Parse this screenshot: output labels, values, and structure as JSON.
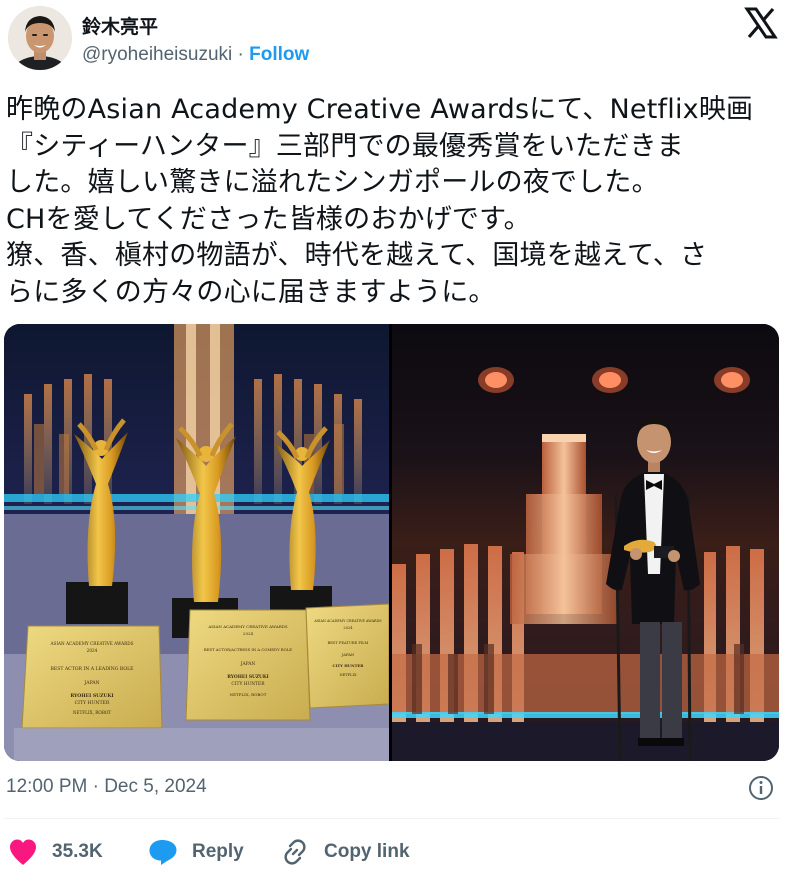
{
  "author": {
    "display_name": "鈴木亮平",
    "handle": "@ryoheiheisuzuki",
    "separator": " · ",
    "follow_label": "Follow"
  },
  "tweet": {
    "lines": [
      "昨晩のAsian Academy Creative Awardsにて、Netflix映画",
      "『シティーハンター』三部門での最優秀賞をいただきま",
      "した。嬉しい驚きに溢れたシンガポールの夜でした。",
      "CHを愛してくださった皆様のおかげです。",
      "獠、香、槇村の物語が、時代を越えて、国境を越えて、さ",
      "らに多くの方々の心に届きますように。"
    ],
    "timestamp": "12:00 PM · Dec 5, 2024"
  },
  "media": {
    "left_photo": {
      "plaques": [
        {
          "header": "ASIAN ACADEMY CREATIVE AWARDS",
          "year": "2024",
          "category": "BEST ACTOR IN A LEADING ROLE",
          "country": "JAPAN",
          "winner": "RYOHEI SUZUKI",
          "title": "CITY HUNTER",
          "credits": "NETFLIX, ROBOT"
        },
        {
          "header": "ASIAN ACADEMY CREATIVE AWARDS",
          "year": "2024",
          "category": "BEST ACTOR/ACTRESS IN A COMEDY ROLE",
          "country": "JAPAN",
          "winner": "RYOHEI SUZUKI",
          "title": "CITY HUNTER",
          "credits": "NETFLIX, ROBOT"
        },
        {
          "header": "ASIAN ACADEMY CREATIVE AWARDS",
          "year": "2024",
          "category": "BEST FEATURE FILM",
          "country": "JAPAN",
          "winner": "CITY HUNTER",
          "title": "",
          "credits": "NETFLIX"
        }
      ]
    }
  },
  "actions": {
    "like_count": "35.3K",
    "reply_label": "Reply",
    "copy_label": "Copy link"
  },
  "colors": {
    "link_blue": "#1d9bf0",
    "muted_text": "#536471",
    "like_pink": "#f91880",
    "text_dark": "#0f1419"
  }
}
